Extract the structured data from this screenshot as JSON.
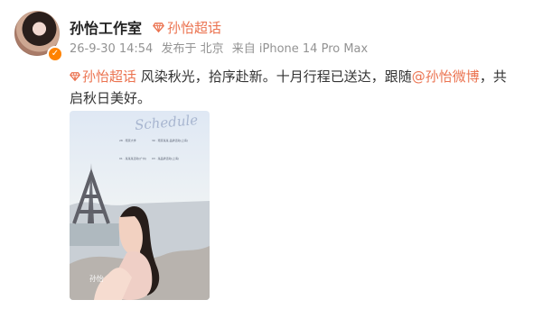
{
  "post": {
    "account_name": "孙怡工作室",
    "super_topic_label": "孙怡超话",
    "timestamp": "26-9-30 14:54",
    "posted_from": "发布于 北京",
    "source": "来自 iPhone 14 Pro Max"
  },
  "content": {
    "topic": "孙怡超话",
    "text_before_mention": " 风染秋光，拾序赴新。十月行程已送达，跟随",
    "mention": "@孙怡微博",
    "text_after_mention": "，共启秋日美好。"
  },
  "poster": {
    "title": "Schedule",
    "items": [
      "28 · 南京大学",
      "30 · 南京某某 品牌活动(上海)",
      "01 · 某某某活动(广州)",
      "03 · 某品牌活动(上海)"
    ],
    "name": "孙怡"
  },
  "colors": {
    "accent": "#eb7350",
    "meta": "#939393",
    "verified": "#ff8200"
  }
}
